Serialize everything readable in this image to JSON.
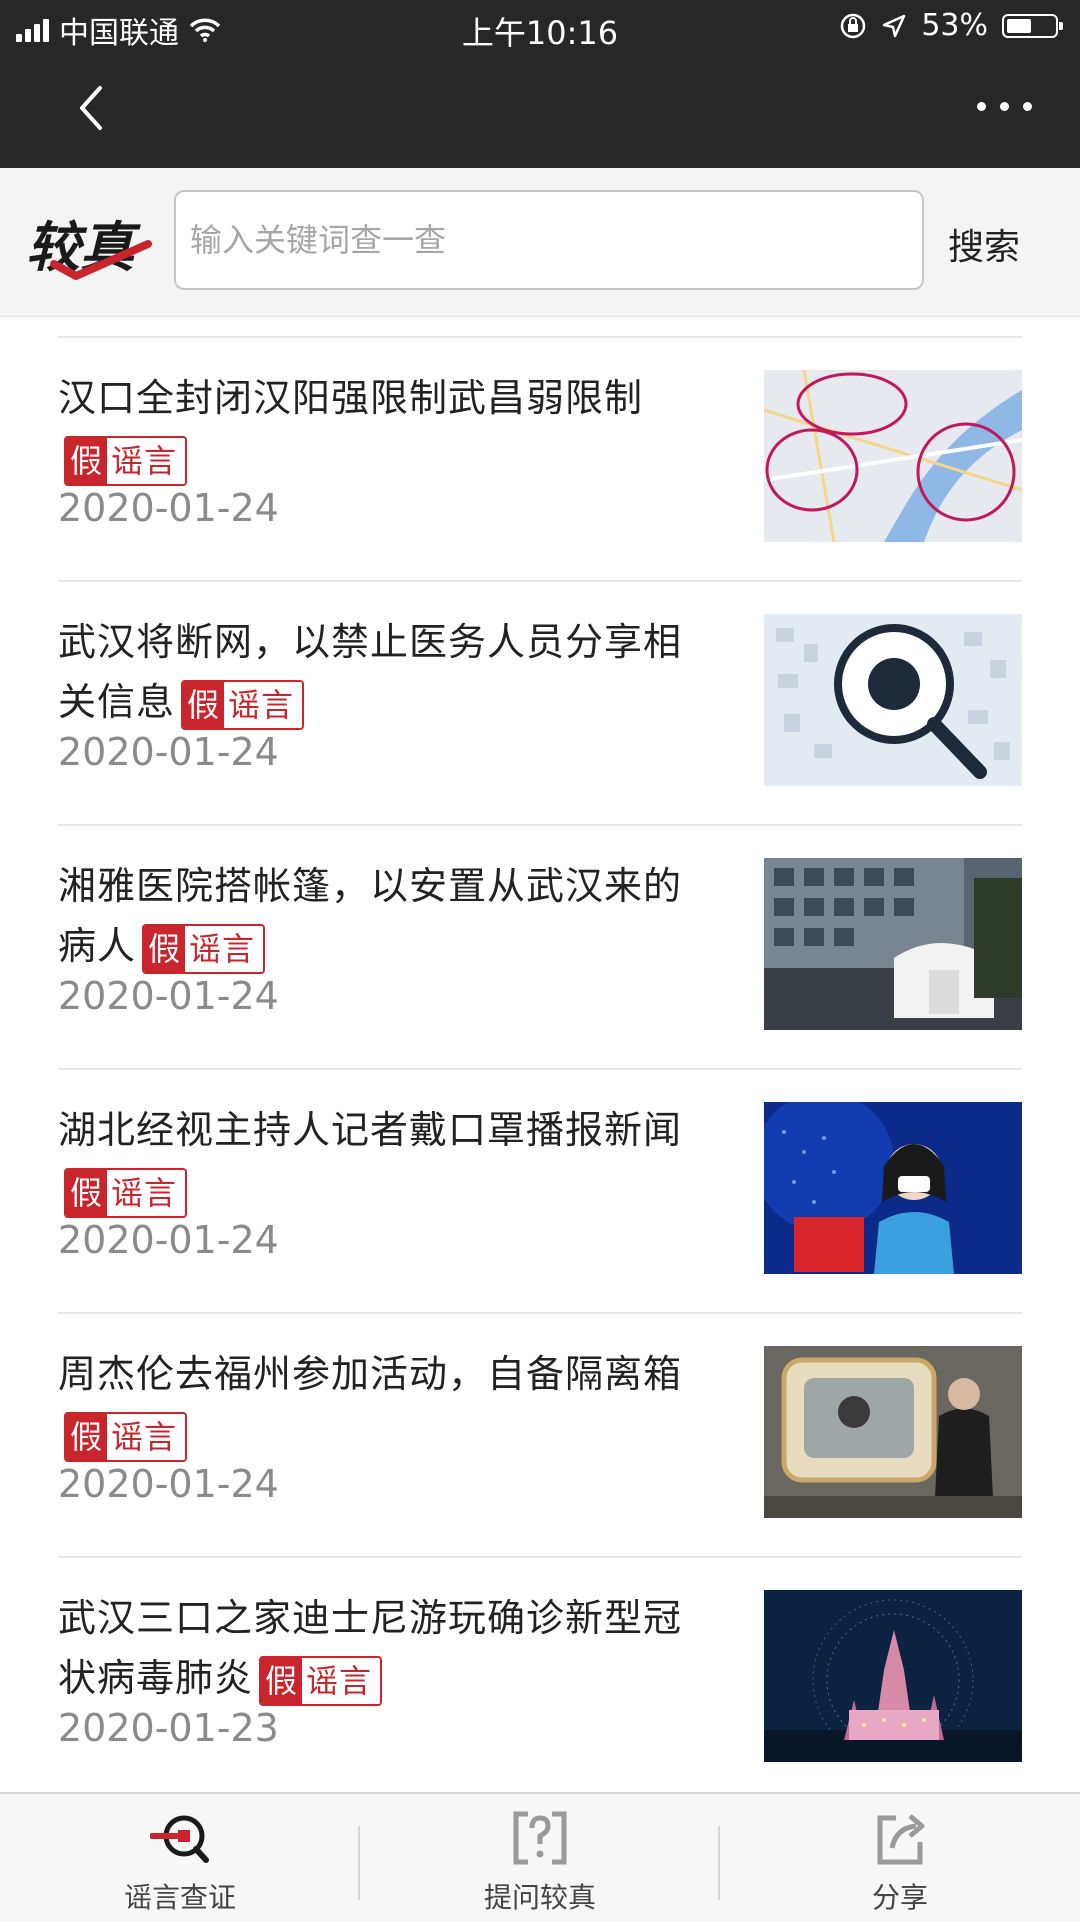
{
  "status_bar": {
    "carrier": "中国联通",
    "time": "上午10:16",
    "battery": "53%",
    "battery_level": 0.53
  },
  "search": {
    "logo_text": "较真",
    "placeholder": "输入关键词查一查",
    "button_label": "搜索"
  },
  "tag": {
    "prefix": "假",
    "label": "谣言"
  },
  "articles": [
    {
      "title": "",
      "date": "2020-01-24",
      "thumbnail": "dark-photo"
    },
    {
      "title": "汉口全封闭汉阳强限制武昌弱限制",
      "date": "2020-01-24",
      "thumbnail": "wuhan-map"
    },
    {
      "title": "武汉将断网，以禁止医务人员分享相关信息",
      "date": "2020-01-24",
      "thumbnail": "rumor-magnifier"
    },
    {
      "title": "湘雅医院搭帐篷，以安置从武汉来的病人",
      "date": "2020-01-24",
      "thumbnail": "hospital-tent"
    },
    {
      "title": "湖北经视主持人记者戴口罩播报新闻",
      "date": "2020-01-24",
      "thumbnail": "news-anchor"
    },
    {
      "title": "周杰伦去福州参加活动，自备隔离箱",
      "date": "2020-01-24",
      "thumbnail": "isolation-box"
    },
    {
      "title": "武汉三口之家迪士尼游玩确诊新型冠状病毒肺炎",
      "date": "2020-01-23",
      "thumbnail": "disney-castle"
    }
  ],
  "tabs": [
    {
      "label": "谣言查证",
      "icon": "search-rumor-icon"
    },
    {
      "label": "提问较真",
      "icon": "question-icon"
    },
    {
      "label": "分享",
      "icon": "share-icon"
    }
  ],
  "colors": {
    "accent": "#c8252c",
    "dark_bar": "#272727"
  }
}
